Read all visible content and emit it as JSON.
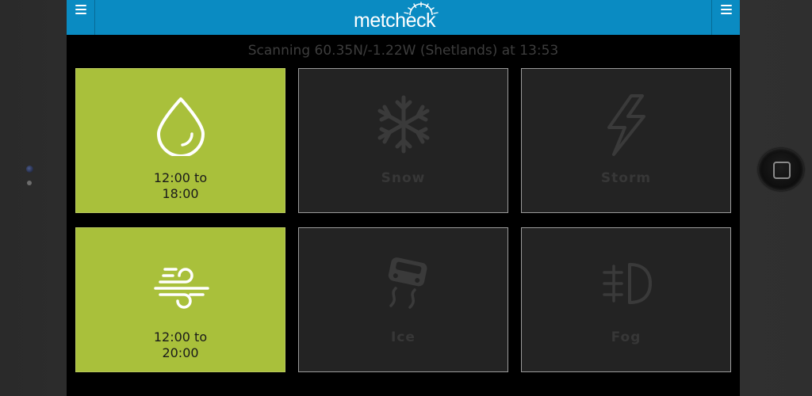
{
  "app": {
    "logo_text": "metcheck"
  },
  "status": {
    "scan_text": "Scanning 60.35N/-1.22W (Shetlands) at 13:53"
  },
  "tiles": [
    {
      "name": "rain",
      "icon": "raindrop-icon",
      "state": "active",
      "label_line1": "12:00 to",
      "label_line2": "18:00"
    },
    {
      "name": "snow",
      "icon": "snowflake-icon",
      "state": "inactive",
      "label": "Snow"
    },
    {
      "name": "storm",
      "icon": "lightning-icon",
      "state": "inactive",
      "label": "Storm"
    },
    {
      "name": "wind",
      "icon": "wind-icon",
      "state": "active",
      "label_line1": "12:00 to",
      "label_line2": "20:00"
    },
    {
      "name": "ice",
      "icon": "skidding-car-icon",
      "state": "inactive",
      "label": "Ice"
    },
    {
      "name": "fog",
      "icon": "fog-light-icon",
      "state": "inactive",
      "label": "Fog"
    }
  ],
  "colors": {
    "header": "#0a8bc2",
    "active_tile": "#a9c03b",
    "inactive_tile": "#232323",
    "background": "#000000"
  }
}
